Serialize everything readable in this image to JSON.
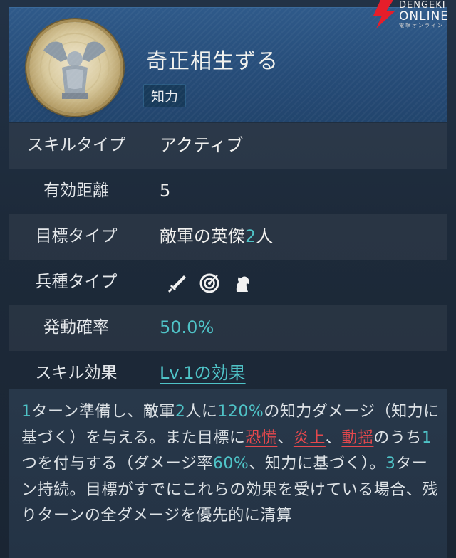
{
  "skill": {
    "name": "奇正相生ずる",
    "category": "知力"
  },
  "watermark": {
    "line1": "DENGEKI",
    "line2": "ONLINE",
    "line3": "電撃オンライン"
  },
  "stats": [
    {
      "label": "スキルタイプ",
      "value": "アクティブ"
    },
    {
      "label": "有効距離",
      "value": "5"
    },
    {
      "label": "目標タイプ",
      "value_prefix": "敵軍の英傑",
      "value_num": "2",
      "value_suffix": "人"
    },
    {
      "label": "兵種タイプ",
      "icons": [
        "sword-icon",
        "bow-target-icon",
        "horse-icon"
      ]
    },
    {
      "label": "発動確率",
      "value": "50.0%"
    },
    {
      "label": "スキル効果",
      "value": "Lv.1の効果"
    }
  ],
  "description": {
    "p1_num1": "1",
    "p1_t1": "ターン準備し、敵軍",
    "p1_num2": "2",
    "p1_t2": "人に",
    "p1_num3": "120%",
    "p1_t3": "の知力ダメージ（知力に基づく）を与える。また目標に",
    "status1": "恐慌",
    "sep1": "、",
    "status2": "炎上",
    "sep2": "、",
    "status3": "動揺",
    "p2_t1": "のうち",
    "p2_num1": "1",
    "p2_t2": "つを付与する（ダメージ率",
    "p2_num2": "60%",
    "p2_t3": "、知力に基づく）。",
    "p2_num3": "3",
    "p2_t4": "ターン持続。目標がすでにこれらの効果を受けている場合、残りターンの全ダメージを優先的に清算"
  },
  "colors": {
    "accent": "#4fc3c7",
    "status_red": "#e5484d",
    "header_blue": "#2a5283"
  }
}
